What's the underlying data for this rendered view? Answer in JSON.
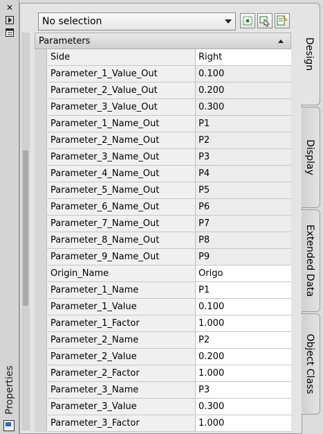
{
  "window": {
    "title": "Properties"
  },
  "selection": {
    "value": "No selection"
  },
  "section": {
    "title": "Parameters"
  },
  "tabs": [
    "Design",
    "Display",
    "Extended Data",
    "Object Class"
  ],
  "rows": [
    {
      "name": "Side",
      "value": "Right",
      "editable": true
    },
    {
      "name": "Parameter_1_Value_Out",
      "value": "0.100",
      "editable": false
    },
    {
      "name": "Parameter_2_Value_Out",
      "value": "0.200",
      "editable": false
    },
    {
      "name": "Parameter_3_Value_Out",
      "value": "0.300",
      "editable": false
    },
    {
      "name": "Parameter_1_Name_Out",
      "value": "P1",
      "editable": false
    },
    {
      "name": "Parameter_2_Name_Out",
      "value": "P2",
      "editable": false
    },
    {
      "name": "Parameter_3_Name_Out",
      "value": "P3",
      "editable": false
    },
    {
      "name": "Parameter_4_Name_Out",
      "value": "P4",
      "editable": false
    },
    {
      "name": "Parameter_5_Name_Out",
      "value": "P5",
      "editable": false
    },
    {
      "name": "Parameter_6_Name_Out",
      "value": "P6",
      "editable": false
    },
    {
      "name": "Parameter_7_Name_Out",
      "value": "P7",
      "editable": false
    },
    {
      "name": "Parameter_8_Name_Out",
      "value": "P8",
      "editable": false
    },
    {
      "name": "Parameter_9_Name_Out",
      "value": "P9",
      "editable": false
    },
    {
      "name": "Origin_Name",
      "value": "Origo",
      "editable": true
    },
    {
      "name": "Parameter_1_Name",
      "value": "P1",
      "editable": true
    },
    {
      "name": "Parameter_1_Value",
      "value": "0.100",
      "editable": true
    },
    {
      "name": "Parameter_1_Factor",
      "value": "1.000",
      "editable": true
    },
    {
      "name": "Parameter_2_Name",
      "value": "P2",
      "editable": true
    },
    {
      "name": "Parameter_2_Value",
      "value": "0.200",
      "editable": true
    },
    {
      "name": "Parameter_2_Factor",
      "value": "1.000",
      "editable": true
    },
    {
      "name": "Parameter_3_Name",
      "value": "P3",
      "editable": true
    },
    {
      "name": "Parameter_3_Value",
      "value": "0.300",
      "editable": true
    },
    {
      "name": "Parameter_3_Factor",
      "value": "1.000",
      "editable": true
    }
  ]
}
